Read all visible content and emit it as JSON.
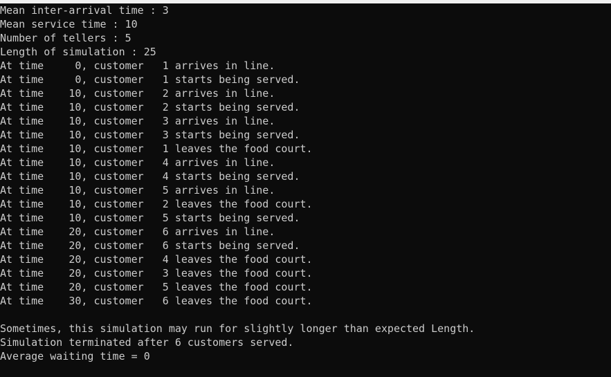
{
  "terminal": {
    "colors": {
      "background": "#0c0c0c",
      "foreground": "#cccccc"
    },
    "lines": [
      "Mean inter-arrival time : 3",
      "Mean service time : 10",
      "Number of tellers : 5",
      "Length of simulation : 25",
      "At time     0, customer   1 arrives in line.",
      "At time     0, customer   1 starts being served.",
      "At time    10, customer   2 arrives in line.",
      "At time    10, customer   2 starts being served.",
      "At time    10, customer   3 arrives in line.",
      "At time    10, customer   3 starts being served.",
      "At time    10, customer   1 leaves the food court.",
      "At time    10, customer   4 arrives in line.",
      "At time    10, customer   4 starts being served.",
      "At time    10, customer   5 arrives in line.",
      "At time    10, customer   2 leaves the food court.",
      "At time    10, customer   5 starts being served.",
      "At time    20, customer   6 arrives in line.",
      "At time    20, customer   6 starts being served.",
      "At time    20, customer   4 leaves the food court.",
      "At time    20, customer   3 leaves the food court.",
      "At time    20, customer   5 leaves the food court.",
      "At time    30, customer   6 leaves the food court.",
      "",
      "Sometimes, this simulation may run for slightly longer than expected Length.",
      "Simulation terminated after 6 customers served.",
      "Average waiting time = 0"
    ]
  }
}
